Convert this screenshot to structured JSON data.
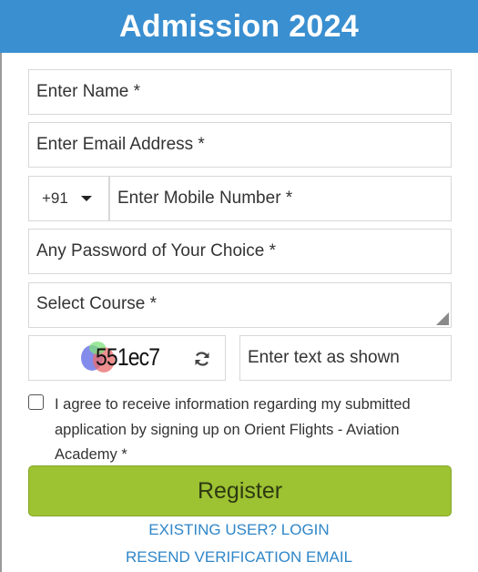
{
  "header": {
    "title": "Admission 2024"
  },
  "form": {
    "name_placeholder": "Enter Name *",
    "email_placeholder": "Enter Email Address *",
    "country_code": "+91",
    "mobile_placeholder": "Enter Mobile Number *",
    "password_placeholder": "Any Password of Your Choice *",
    "course_placeholder": "Select Course *",
    "captcha_code": "551ec7",
    "captcha_input_placeholder": "Enter text as shown",
    "agree_text": "I agree to receive information regarding my submitted application by signing up on Orient Flights - Aviation Academy *",
    "agree_checked": false,
    "register_label": "Register"
  },
  "links": {
    "existing_user": "EXISTING USER? LOGIN",
    "resend_verification": "RESEND VERIFICATION EMAIL"
  },
  "colors": {
    "header_bg": "#3a8fd0",
    "register_bg": "#9dc232",
    "link": "#2f86c8"
  },
  "icons": {
    "refresh": "refresh-icon",
    "dropdown": "chevron-down-icon",
    "resize": "resize-handle-icon"
  }
}
